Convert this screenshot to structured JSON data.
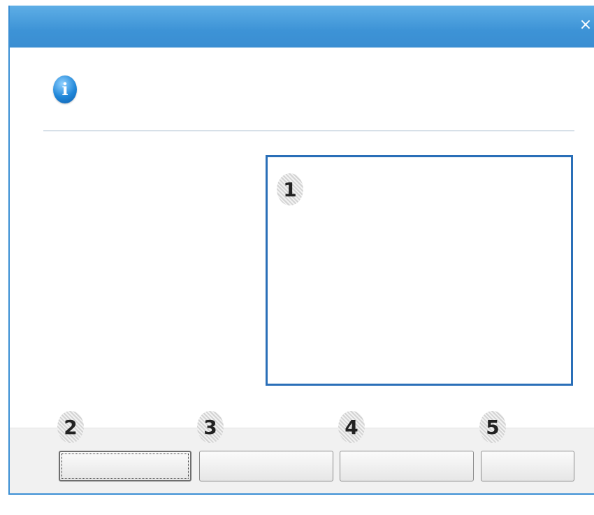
{
  "window": {
    "close_label": "×"
  },
  "info_icon": {
    "glyph": "i"
  },
  "callouts": {
    "c1": "1",
    "c2": "2",
    "c3": "3",
    "c4": "4",
    "c5": "5"
  },
  "buttons": {
    "b1": "",
    "b2": "",
    "b3": "",
    "b4": ""
  },
  "colors": {
    "titlebar": "#3d93d6",
    "panel_border": "#2a6fb8"
  }
}
